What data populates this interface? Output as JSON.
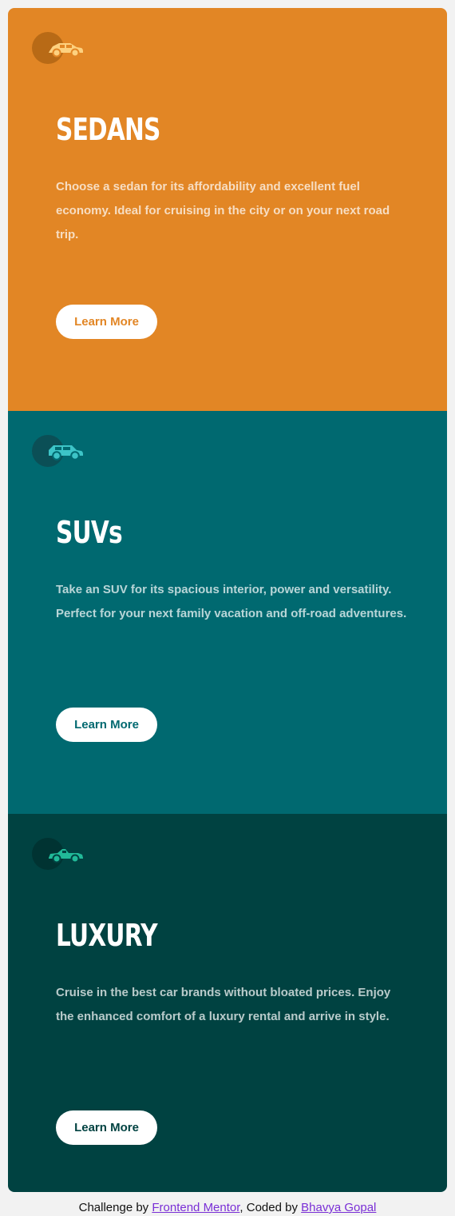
{
  "cards": [
    {
      "title": "SEDANS",
      "description": "Choose a sedan for its affordability and excellent fuel economy. Ideal for cruising in the city or on your next road trip.",
      "button": "Learn More",
      "icon": "sedan-car-icon",
      "color": "#e28625"
    },
    {
      "title": "SUVs",
      "description": "Take an SUV for its spacious interior, power and versatility. Perfect for your next family vacation and off-road adventures.",
      "button": "Learn More",
      "icon": "suv-car-icon",
      "color": "#006970"
    },
    {
      "title": "LUXURY",
      "description": "Cruise in the best car brands without bloated prices. Enjoy the enhanced comfort of a luxury rental and arrive in style.",
      "button": "Learn More",
      "icon": "luxury-car-icon",
      "color": "#004241"
    }
  ],
  "footer": {
    "prefix": "Challenge by ",
    "link1": "Frontend Mentor",
    "middle": ", Coded by ",
    "link2": "Bhavya Gopal"
  }
}
